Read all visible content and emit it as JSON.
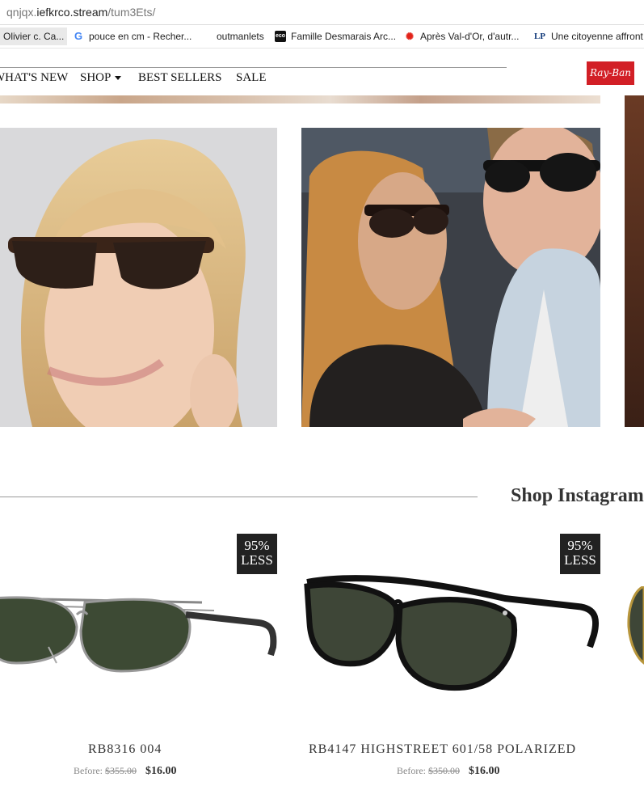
{
  "browser": {
    "url_prefix": "qnjqx.",
    "url_domain": "iefkrco.stream",
    "url_path": "/tum3Ets/",
    "bookmarks": [
      {
        "label": "Olivier c. Ca...",
        "icon": "bookmark-icon"
      },
      {
        "label": "pouce en cm - Recher...",
        "icon": "google-icon"
      },
      {
        "label": "outmanlets",
        "icon": ""
      },
      {
        "label": "Famille Desmarais Arc...",
        "icon": "eco-icon"
      },
      {
        "label": "Après Val-d'Or, d'autr...",
        "icon": "radio-canada-icon"
      },
      {
        "label": "Une citoyenne affront",
        "icon": "lp-icon"
      }
    ]
  },
  "nav": {
    "items": [
      "WHAT'S NEW",
      "SHOP",
      "BEST SELLERS",
      "SALE"
    ],
    "logo_text": "Ray-Ban"
  },
  "section": {
    "title": "Shop Instagram"
  },
  "products": [
    {
      "badge_pct": "95%",
      "badge_word": "LESS",
      "name": "RB8316 004",
      "before_label": "Before:",
      "before": "$355.00",
      "price": "$16.00"
    },
    {
      "badge_pct": "95%",
      "badge_word": "LESS",
      "name": "RB4147 HIGHSTREET 601/58 POLARIZED",
      "before_label": "Before:",
      "before": "$350.00",
      "price": "$16.00"
    }
  ],
  "colors": {
    "brand": "#d21f26",
    "badge": "#222222"
  }
}
